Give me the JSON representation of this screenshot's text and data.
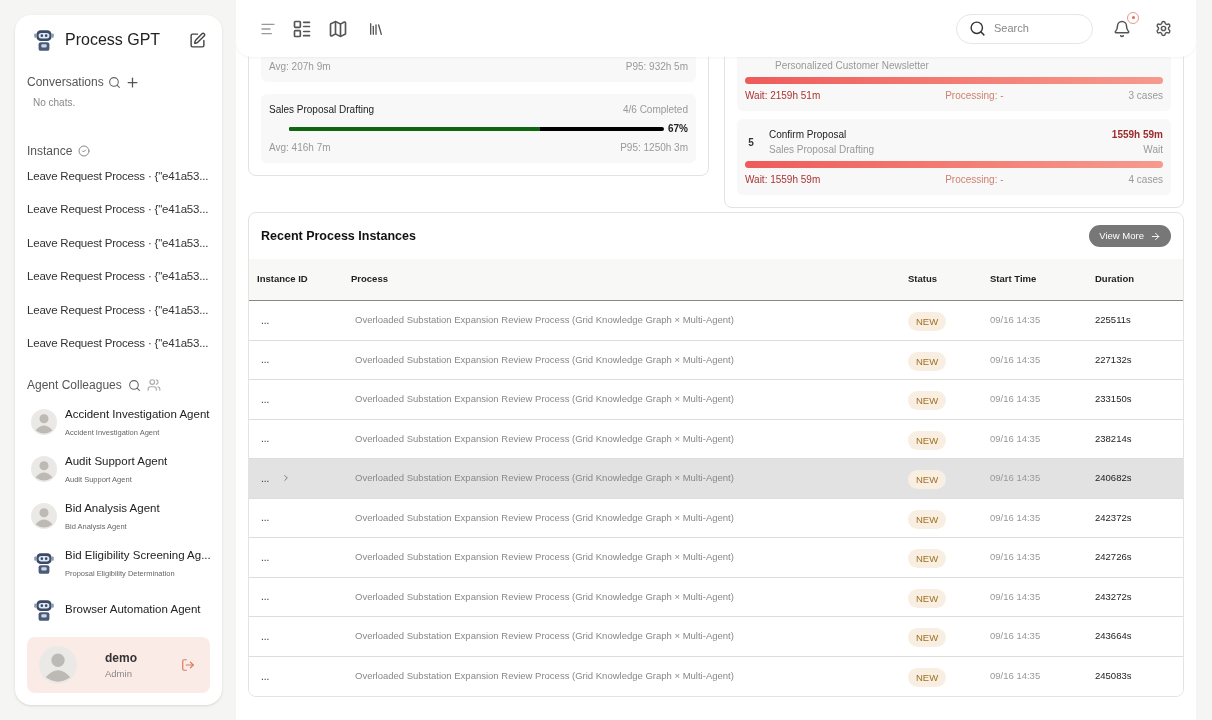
{
  "sidebar": {
    "app_title": "Process GPT",
    "conversations": {
      "title": "Conversations",
      "empty_text": "No chats."
    },
    "instance": {
      "title": "Instance",
      "items": [
        "Leave Request Process · {\"e41a53...",
        "Leave Request Process · {\"e41a53...",
        "Leave Request Process · {\"e41a53...",
        "Leave Request Process · {\"e41a53...",
        "Leave Request Process · {\"e41a53...",
        "Leave Request Process · {\"e41a53..."
      ]
    },
    "agents": {
      "title": "Agent Colleagues",
      "items": [
        {
          "name": "Accident Investigation Agent",
          "role": "Accident Investigation Agent",
          "kind": "person"
        },
        {
          "name": "Audit Support Agent",
          "role": "Audit Support Agent",
          "kind": "person"
        },
        {
          "name": "Bid Analysis Agent",
          "role": "Bid Analysis Agent",
          "kind": "person"
        },
        {
          "name": "Bid Eligibility Screening Ag...",
          "role": "Proposal Eligibility Determination",
          "kind": "robot"
        },
        {
          "name": "Browser Automation Agent",
          "kind": "robot"
        }
      ]
    },
    "user": {
      "name": "demo",
      "role": "Admin"
    }
  },
  "header": {
    "search": {
      "placeholder": "Search"
    },
    "notification_dot": true
  },
  "process_card": {
    "items": [
      {
        "avg": "Avg: 207h 9m",
        "p95": "P95: 932h 5m"
      },
      {
        "name": "Sales Proposal Drafting",
        "completed": "4/6 Completed",
        "level": 0.67,
        "percent": "67%",
        "avg": "Avg: 416h 7m",
        "p95": "P95: 1250h 3m"
      }
    ]
  },
  "bottleneck_card": {
    "items": [
      {
        "subtitle": "Personalized Customer Newsletter",
        "wait": "Wait: 2159h 51m",
        "processing": "Processing: -",
        "cases": "3 cases"
      },
      {
        "rank": "5",
        "name": "Confirm Proposal",
        "subtitle": "Sales Proposal Drafting",
        "time": "1559h 59m",
        "time_label": "Wait",
        "wait": "Wait: 1559h 59m",
        "processing": "Processing: -",
        "cases": "4 cases"
      }
    ]
  },
  "recent": {
    "title": "Recent Process Instances",
    "view_more": "View More",
    "columns": [
      "Instance ID",
      "Process",
      "Status",
      "Start Time",
      "Duration"
    ],
    "rows": [
      {
        "id": "...",
        "process": "Overloaded Substation Expansion Review Process (Grid Knowledge Graph × Multi-Agent)",
        "status": "NEW",
        "start": "09/16 14:35",
        "duration": "225511s",
        "hovered": false
      },
      {
        "id": "...",
        "process": "Overloaded Substation Expansion Review Process (Grid Knowledge Graph × Multi-Agent)",
        "status": "NEW",
        "start": "09/16 14:35",
        "duration": "227132s",
        "hovered": false
      },
      {
        "id": "...",
        "process": "Overloaded Substation Expansion Review Process (Grid Knowledge Graph × Multi-Agent)",
        "status": "NEW",
        "start": "09/16 14:35",
        "duration": "233150s",
        "hovered": false
      },
      {
        "id": "...",
        "process": "Overloaded Substation Expansion Review Process (Grid Knowledge Graph × Multi-Agent)",
        "status": "NEW",
        "start": "09/16 14:35",
        "duration": "238214s",
        "hovered": false
      },
      {
        "id": "...",
        "process": "Overloaded Substation Expansion Review Process (Grid Knowledge Graph × Multi-Agent)",
        "status": "NEW",
        "start": "09/16 14:35",
        "duration": "240682s",
        "hovered": true
      },
      {
        "id": "...",
        "process": "Overloaded Substation Expansion Review Process (Grid Knowledge Graph × Multi-Agent)",
        "status": "NEW",
        "start": "09/16 14:35",
        "duration": "242372s",
        "hovered": false
      },
      {
        "id": "...",
        "process": "Overloaded Substation Expansion Review Process (Grid Knowledge Graph × Multi-Agent)",
        "status": "NEW",
        "start": "09/16 14:35",
        "duration": "242726s",
        "hovered": false
      },
      {
        "id": "...",
        "process": "Overloaded Substation Expansion Review Process (Grid Knowledge Graph × Multi-Agent)",
        "status": "NEW",
        "start": "09/16 14:35",
        "duration": "243272s",
        "hovered": false
      },
      {
        "id": "...",
        "process": "Overloaded Substation Expansion Review Process (Grid Knowledge Graph × Multi-Agent)",
        "status": "NEW",
        "start": "09/16 14:35",
        "duration": "243664s",
        "hovered": false
      },
      {
        "id": "...",
        "process": "Overloaded Substation Expansion Review Process (Grid Knowledge Graph × Multi-Agent)",
        "status": "NEW",
        "start": "09/16 14:35",
        "duration": "245083s",
        "hovered": false
      }
    ]
  }
}
